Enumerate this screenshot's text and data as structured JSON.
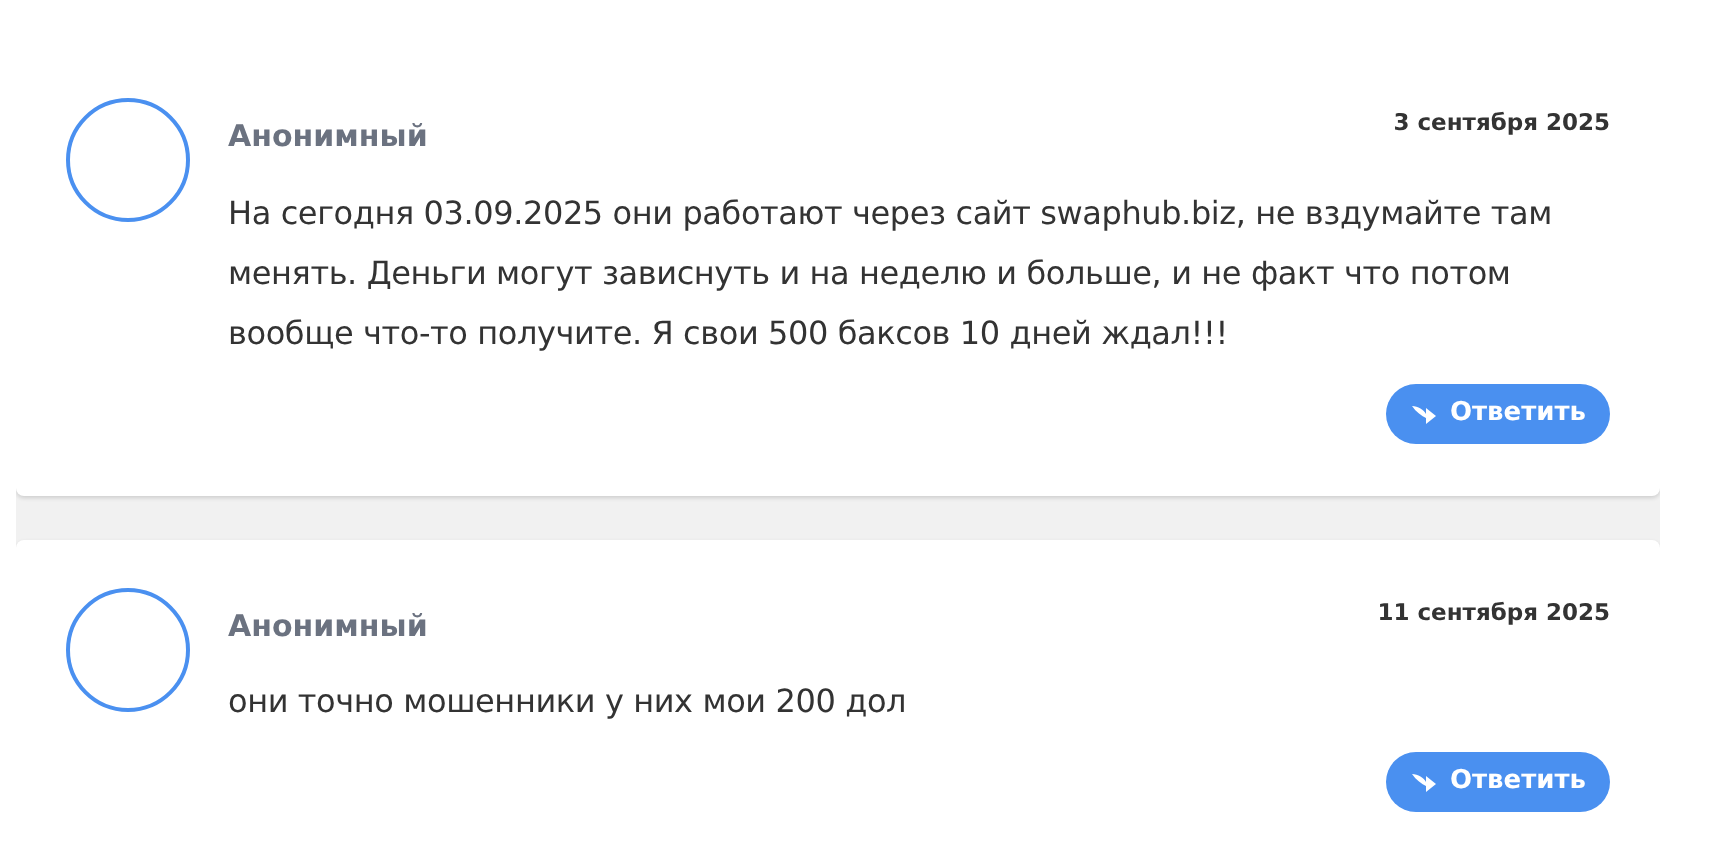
{
  "comments": [
    {
      "author": "Анонимный",
      "date": "3 сентября 2025",
      "text": "На сегодня 03.09.2025 они работают через сайт swaphub.biz, не вздумайте там менять. Деньги могут зависнуть и на неделю и больше, и не факт что потом вообще что-то получите. Я свои 500 баксов 10 дней ждал!!!",
      "reply_button": "Ответить"
    },
    {
      "author": "Анонимный",
      "date": "11 сентября 2025",
      "text": "они точно мошенники у них мои 200 дол",
      "reply_button": "Ответить"
    }
  ]
}
